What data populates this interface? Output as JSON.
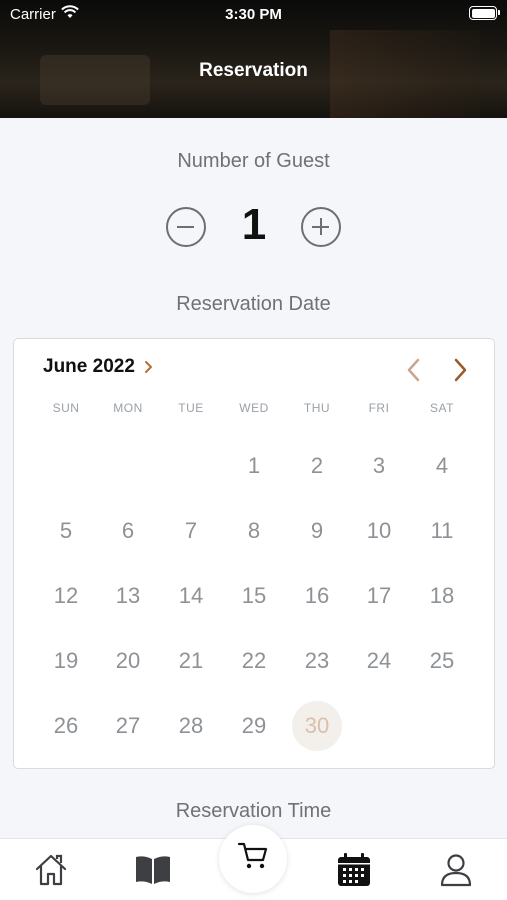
{
  "status_bar": {
    "carrier": "Carrier",
    "time": "3:30 PM"
  },
  "header": {
    "title": "Reservation"
  },
  "guests": {
    "label": "Number of Guest",
    "count": "1"
  },
  "date_section": {
    "label": "Reservation Date"
  },
  "calendar": {
    "month_label": "June 2022",
    "weekdays": [
      "SUN",
      "MON",
      "TUE",
      "WED",
      "THU",
      "FRI",
      "SAT"
    ],
    "days": [
      "1",
      "2",
      "3",
      "4",
      "5",
      "6",
      "7",
      "8",
      "9",
      "10",
      "11",
      "12",
      "13",
      "14",
      "15",
      "16",
      "17",
      "18",
      "19",
      "20",
      "21",
      "22",
      "23",
      "24",
      "25",
      "26",
      "27",
      "28",
      "29",
      "30"
    ],
    "selected_day": "30",
    "accent_color": "#b0703a"
  },
  "time_section": {
    "label": "Reservation Time"
  },
  "tab_bar": {
    "items": [
      {
        "name": "home",
        "icon": "home-icon",
        "active": false
      },
      {
        "name": "menu",
        "icon": "book-icon",
        "active": false
      },
      {
        "name": "cart",
        "icon": "cart-icon",
        "active": false
      },
      {
        "name": "reservation",
        "icon": "calendar-icon",
        "active": true
      },
      {
        "name": "profile",
        "icon": "user-icon",
        "active": false
      }
    ]
  }
}
